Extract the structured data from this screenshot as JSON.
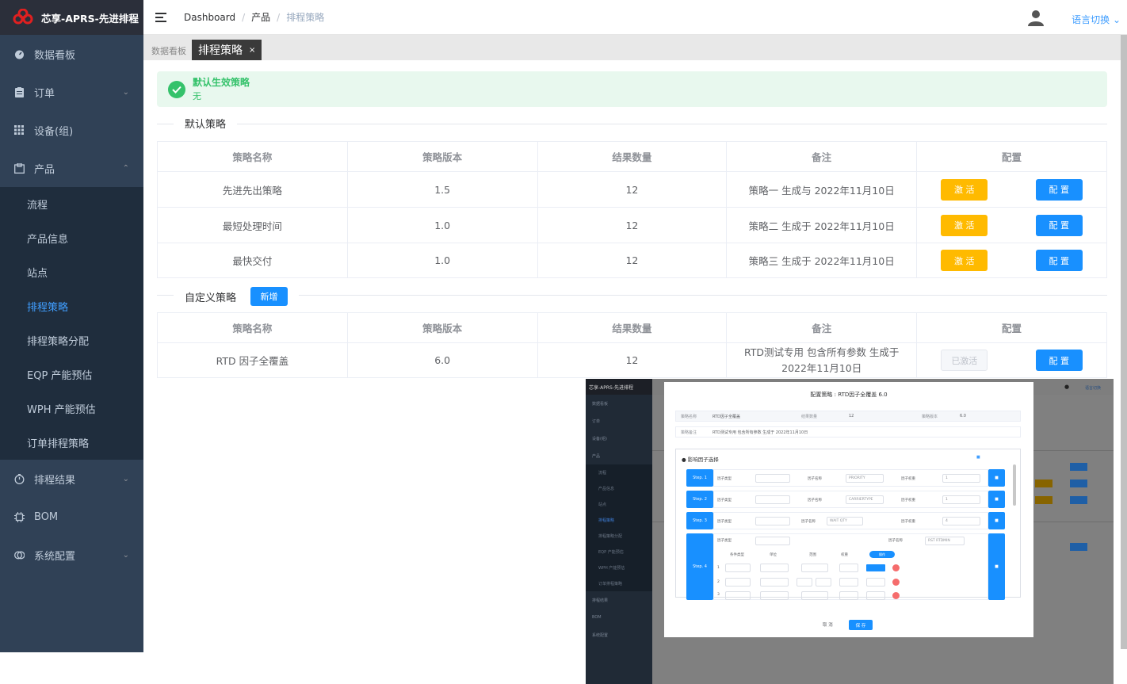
{
  "app": {
    "title": "芯享-APRS-先进排程"
  },
  "sidebar": {
    "items": [
      {
        "label": "数据看板"
      },
      {
        "label": "订单"
      },
      {
        "label": "设备(组)"
      },
      {
        "label": "产品"
      },
      {
        "label": "排程结果"
      },
      {
        "label": "BOM"
      },
      {
        "label": "系统配置"
      }
    ],
    "product_sub": [
      {
        "label": "流程"
      },
      {
        "label": "产品信息"
      },
      {
        "label": "站点"
      },
      {
        "label": "排程策略"
      },
      {
        "label": "排程策略分配"
      },
      {
        "label": "EQP 产能预估"
      },
      {
        "label": "WPH 产能预估"
      },
      {
        "label": "订单排程策略"
      }
    ]
  },
  "header": {
    "breadcrumb": [
      "Dashboard",
      "产品",
      "排程策略"
    ],
    "lang": "语言切换"
  },
  "tags": {
    "dashboard": "数据看板",
    "current": "排程策略",
    "close": "×"
  },
  "alert": {
    "title": "默认生效策略",
    "value": "无"
  },
  "default_section": {
    "title": "默认策略",
    "headers": [
      "策略名称",
      "策略版本",
      "结果数量",
      "备注",
      "配置"
    ],
    "rows": [
      {
        "name": "先进先出策略",
        "version": "1.5",
        "count": "12",
        "note": "策略一 生成与 2022年11月10日",
        "activate": "激 活",
        "config": "配 置"
      },
      {
        "name": "最短处理时间",
        "version": "1.0",
        "count": "12",
        "note": "策略二 生成于 2022年11月10日",
        "activate": "激 活",
        "config": "配 置"
      },
      {
        "name": "最快交付",
        "version": "1.0",
        "count": "12",
        "note": "策略三 生成于 2022年11月10日",
        "activate": "激 活",
        "config": "配 置"
      }
    ]
  },
  "custom_section": {
    "title": "自定义策略",
    "add_label": "新增",
    "headers": [
      "策略名称",
      "策略版本",
      "结果数量",
      "备注",
      "配置"
    ],
    "rows": [
      {
        "name": "RTD 因子全覆盖",
        "version": "6.0",
        "count": "12",
        "note": "RTD测试专用 包含所有参数 生成于 2022年11月10日",
        "activate": "已激活",
        "config": "配 置"
      }
    ]
  },
  "inset": {
    "app_title": "芯享-APRS-先进排程",
    "dialog_title": "配置策略 : RTD因子全覆盖 6.0",
    "name_label": "策略名称",
    "name_value": "RTD因子全覆盖",
    "count_label": "结果数量",
    "count_value": "12",
    "version_label": "策略版本",
    "version_value": "6.0",
    "note_label": "策略备注",
    "note_value": "RTD测试专用 包含所有参数 生成于 2022年11月10日",
    "section": "影响因子选择",
    "steps": [
      "Step. 1",
      "Step. 2",
      "Step. 3",
      "Step. 4"
    ],
    "factor_type": "因子类型",
    "factor_name": "因子名称",
    "factor_weight": "因子权重",
    "weight_values": [
      "1",
      "1",
      "4"
    ],
    "factor_values": [
      "PRIORITY",
      "CARRIERTYPE",
      "WAIT QTY"
    ],
    "step4_name": "RST RTDMIN",
    "step4_headers": [
      "条件类型",
      "单位",
      "范围",
      "权重",
      "操作"
    ],
    "step4_rows": [
      "1",
      "2",
      "3"
    ],
    "cancel": "取 消",
    "save": "保 存"
  }
}
